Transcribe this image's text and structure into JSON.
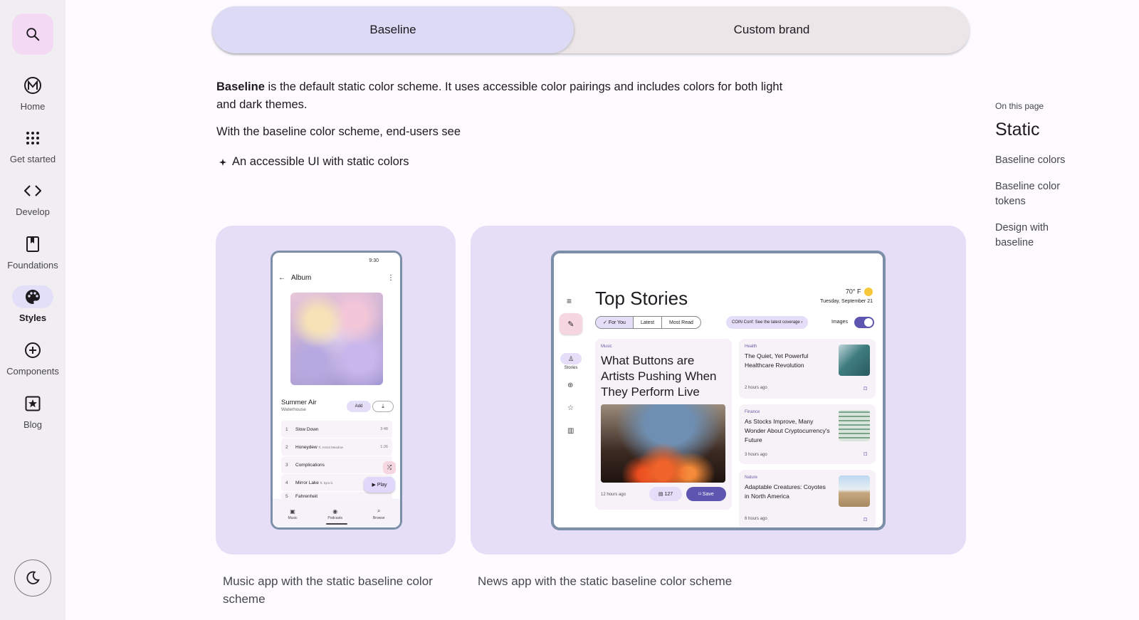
{
  "rail": {
    "items": [
      {
        "label": "Home",
        "icon": "material-logo-icon"
      },
      {
        "label": "Get started",
        "icon": "apps-grid-icon"
      },
      {
        "label": "Develop",
        "icon": "code-icon"
      },
      {
        "label": "Foundations",
        "icon": "book-icon"
      },
      {
        "label": "Styles",
        "icon": "palette-icon"
      },
      {
        "label": "Components",
        "icon": "add-circle-icon"
      },
      {
        "label": "Blog",
        "icon": "star-box-icon"
      }
    ]
  },
  "toggle": {
    "selected": "Baseline",
    "other": "Custom brand"
  },
  "content": {
    "intro_bold": "Baseline",
    "intro_rest": " is the default static color scheme. It uses accessible color pairings and includes colors for both light and dark themes.",
    "subhead": "With the baseline color scheme, end-users see",
    "bullet": "An accessible UI with static colors"
  },
  "music": {
    "time": "9:30",
    "title": "Album",
    "song": "Summer Air",
    "artist": "Waterhouse",
    "add": "Add",
    "tracks": [
      {
        "n": "1",
        "title": "Slow Down",
        "dur": "3:48"
      },
      {
        "n": "2",
        "title": "Honeydew",
        "feat": "ft. Astral Meadow",
        "dur": "1:26"
      },
      {
        "n": "3",
        "title": "Complications",
        "dur": ""
      },
      {
        "n": "4",
        "title": "Mirror Lake",
        "feat": "ft. kyra b.",
        "dur": ""
      },
      {
        "n": "5",
        "title": "Fahrenheit",
        "dur": ""
      }
    ],
    "play": "Play",
    "nav": [
      "Music",
      "Podcasts",
      "Browse"
    ],
    "caption": "Music app with the static baseline color scheme"
  },
  "news": {
    "title": "Top Stories",
    "temp": "70° F",
    "date": "Tuesday, September 21",
    "tabs": [
      "For You",
      "Latest",
      "Most Read"
    ],
    "chip": "COIN Conf: See the latest coverage",
    "images_label": "Images",
    "stories_label": "Stories",
    "feature": {
      "category": "Music",
      "headline": "What Buttons are Artists Pushing When They Perform Live",
      "age": "12 hours ago",
      "comments": "127",
      "save": "Save"
    },
    "stories": [
      {
        "category": "Health",
        "headline": "The Quiet, Yet Powerful Healthcare Revolution",
        "age": "2 hours ago"
      },
      {
        "category": "Finance",
        "headline": "As Stocks Improve, Many Wonder About Cryptocurrency's Future",
        "age": "3 hours ago"
      },
      {
        "category": "Nature",
        "headline": "Adaptable Creatures: Coyotes in North America",
        "age": "6 hours ago"
      }
    ],
    "caption": "News app with the static baseline color scheme"
  },
  "toc": {
    "heading": "On this page",
    "title": "Static",
    "links": [
      "Baseline colors",
      "Baseline color tokens",
      "Design with baseline"
    ]
  },
  "colors": {
    "rail_bg": "#f1eef1",
    "search_bg": "#f3d9f4",
    "selected_seg": "#dcdaf5",
    "card_bg": "#e6def6",
    "primary": "#5e55b0"
  }
}
